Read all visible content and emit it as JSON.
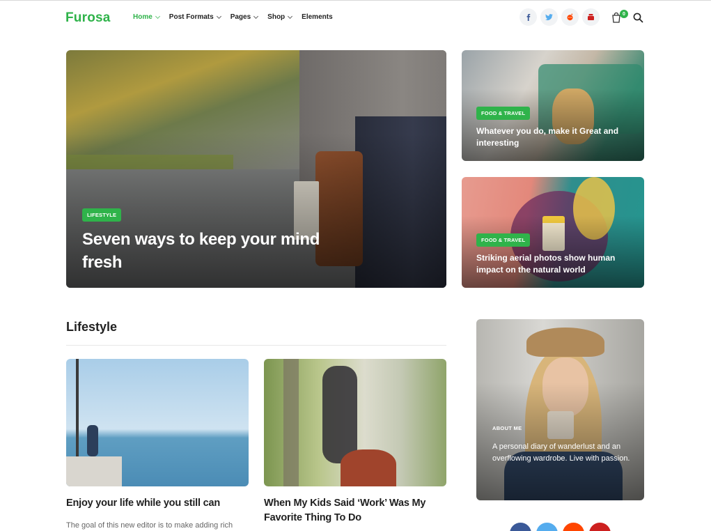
{
  "header": {
    "logo": "Furosa",
    "nav": [
      {
        "label": "Home",
        "active": true,
        "has_dropdown": true
      },
      {
        "label": "Post Formats",
        "active": false,
        "has_dropdown": true
      },
      {
        "label": "Pages",
        "active": false,
        "has_dropdown": true
      },
      {
        "label": "Shop",
        "active": false,
        "has_dropdown": true
      },
      {
        "label": "Elements",
        "active": false,
        "has_dropdown": false
      }
    ],
    "social_icons": [
      "facebook-icon",
      "twitter-icon",
      "reddit-icon",
      "youtube-icon"
    ],
    "cart_count": "0"
  },
  "hero": {
    "main": {
      "category": "LIFESTYLE",
      "title": "Seven ways to keep your mind fresh"
    },
    "side": [
      {
        "category": "FOOD & TRAVEL",
        "title": "Whatever you do, make it Great and interesting"
      },
      {
        "category": "FOOD & TRAVEL",
        "title": "Striking aerial photos show human impact on the natural world"
      }
    ]
  },
  "section": {
    "title": "Lifestyle",
    "posts": [
      {
        "title": "Enjoy your life while you still can",
        "excerpt": "The goal of this new editor is to make adding rich"
      },
      {
        "title": "When My Kids Said ‘Work’ Was My Favorite Thing To Do"
      }
    ]
  },
  "about": {
    "label": "ABOUT ME",
    "text": "A personal diary of wanderlust and an overflowing wardrobe. Live with passion."
  },
  "colors": {
    "accent": "#2fb34a",
    "facebook": "#3b5998",
    "twitter": "#55acee",
    "reddit": "#ff4500",
    "youtube": "#cd201f"
  }
}
